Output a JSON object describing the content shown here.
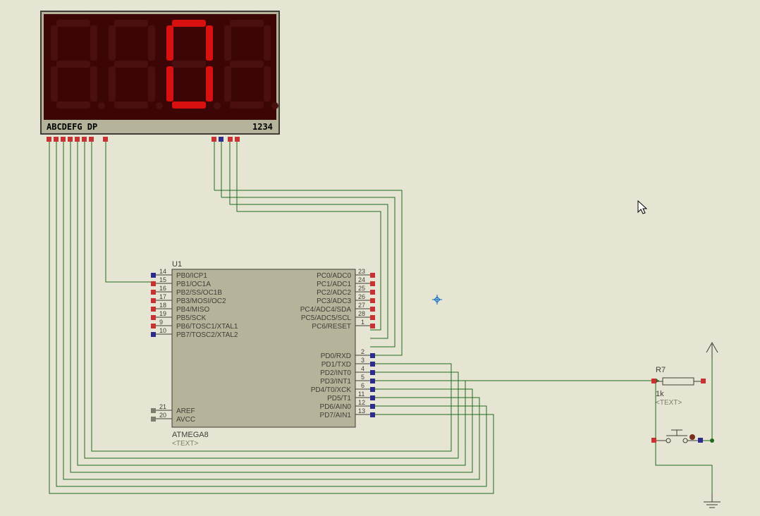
{
  "display": {
    "segment_label": "ABCDEFG DP",
    "digit_label": "1234",
    "lit_digit_index": 2,
    "lit_char": "0"
  },
  "chip": {
    "ref": "U1",
    "part": "ATMEGA8",
    "placeholder": "<TEXT>",
    "left_pins": [
      {
        "num": "14",
        "name": "PB0/ICP1"
      },
      {
        "num": "15",
        "name": "PB1/OC1A"
      },
      {
        "num": "16",
        "name": "PB2/SS/OC1B"
      },
      {
        "num": "17",
        "name": "PB3/MOSI/OC2"
      },
      {
        "num": "18",
        "name": "PB4/MISO"
      },
      {
        "num": "19",
        "name": "PB5/SCK"
      },
      {
        "num": "9",
        "name": "PB6/TOSC1/XTAL1"
      },
      {
        "num": "10",
        "name": "PB7/TOSC2/XTAL2"
      }
    ],
    "left_pins2": [
      {
        "num": "21",
        "name": "AREF"
      },
      {
        "num": "20",
        "name": "AVCC"
      }
    ],
    "right_pins": [
      {
        "num": "23",
        "name": "PC0/ADC0"
      },
      {
        "num": "24",
        "name": "PC1/ADC1"
      },
      {
        "num": "25",
        "name": "PC2/ADC2"
      },
      {
        "num": "26",
        "name": "PC3/ADC3"
      },
      {
        "num": "27",
        "name": "PC4/ADC4/SDA"
      },
      {
        "num": "28",
        "name": "PC5/ADC5/SCL"
      },
      {
        "num": "1",
        "name": "PC6/RESET"
      }
    ],
    "right_pins2": [
      {
        "num": "2",
        "name": "PD0/RXD"
      },
      {
        "num": "3",
        "name": "PD1/TXD"
      },
      {
        "num": "4",
        "name": "PD2/INT0"
      },
      {
        "num": "5",
        "name": "PD3/INT1"
      },
      {
        "num": "6",
        "name": "PD4/T0/XCK"
      },
      {
        "num": "11",
        "name": "PD5/T1"
      },
      {
        "num": "12",
        "name": "PD6/AIN0"
      },
      {
        "num": "13",
        "name": "PD7/AIN1"
      }
    ]
  },
  "resistor": {
    "ref": "R7",
    "value": "1k",
    "placeholder": "<TEXT>"
  }
}
